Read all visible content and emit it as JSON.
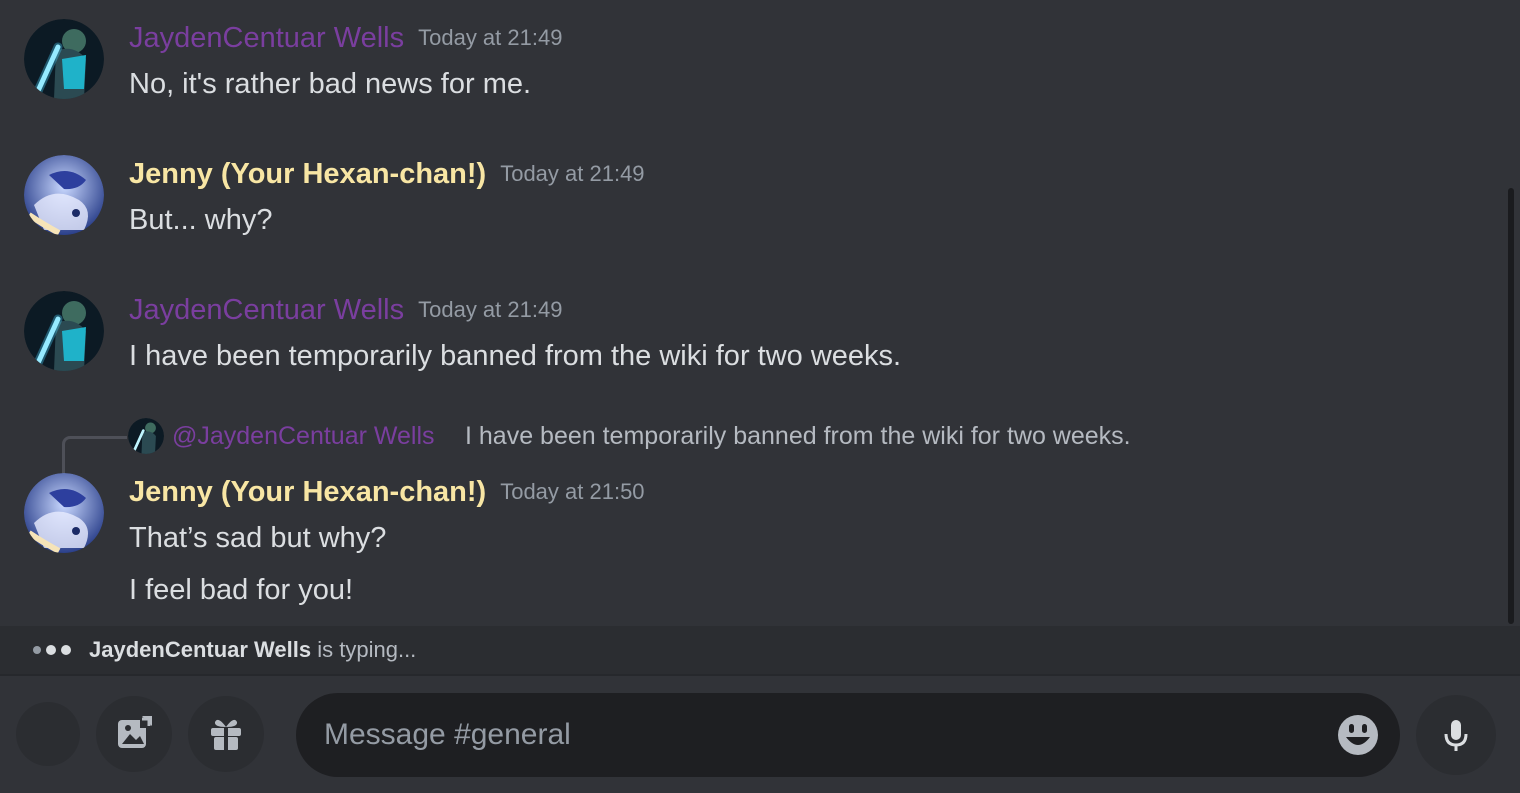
{
  "messages": [
    {
      "author": "JaydenCentuar Wells",
      "time": "Today at 21:49",
      "lines": [
        "No, it's rather bad news for me."
      ]
    },
    {
      "author": "Jenny (Your Hexan-chan!)",
      "time": "Today at 21:49",
      "lines": [
        "But... why?"
      ]
    },
    {
      "author": "JaydenCentuar Wells",
      "time": "Today at 21:49",
      "lines": [
        "I have been temporarily banned from the wiki for two weeks."
      ]
    },
    {
      "author": "Jenny (Your Hexan-chan!)",
      "time": "Today at 21:50",
      "lines": [
        "That’s sad but why?",
        "I feel bad for you!"
      ]
    }
  ],
  "reply": {
    "mention": "@JaydenCentuar Wells",
    "text": "I have been temporarily banned from the wiki for two weeks."
  },
  "typing": {
    "user": "JaydenCentuar Wells",
    "suffix": "is typing..."
  },
  "composer": {
    "placeholder": "Message #general"
  },
  "icons": {
    "image": "image-icon",
    "gift": "gift-icon",
    "emoji": "emoji-icon",
    "mic": "microphone-icon"
  },
  "colors": {
    "background": "#313338",
    "jayden": "#7a3e9f",
    "jenny": "#f8e6a4",
    "timestamp": "#949ba4"
  }
}
